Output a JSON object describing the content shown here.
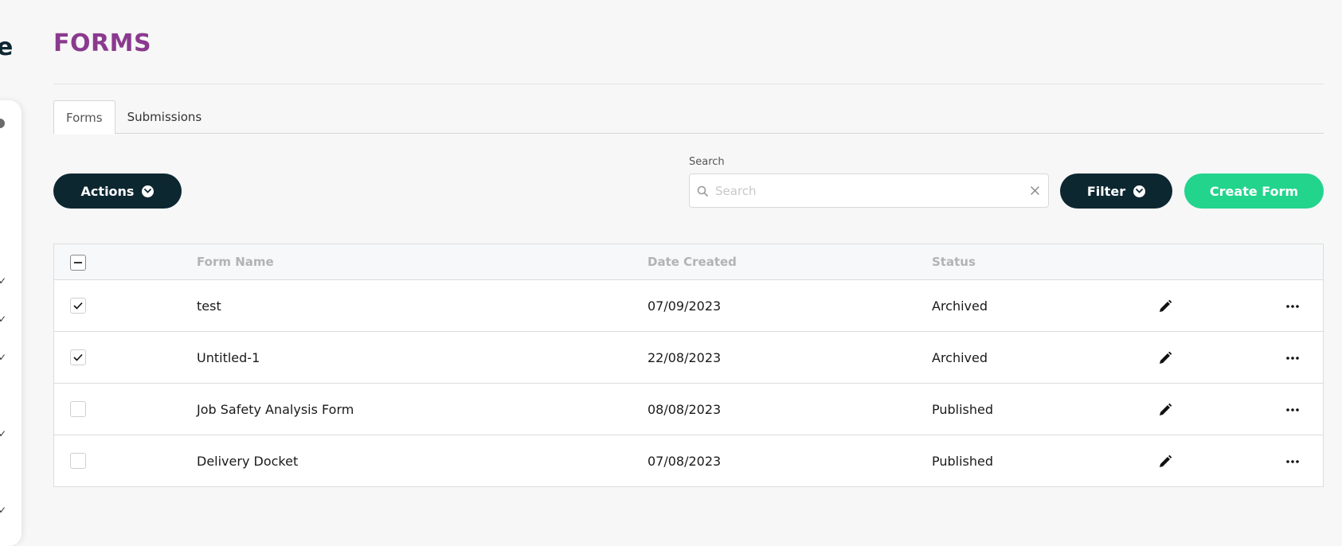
{
  "brand": {
    "fragment": "e"
  },
  "page": {
    "title": "FORMS"
  },
  "tabs": [
    {
      "label": "Forms",
      "active": true
    },
    {
      "label": "Submissions",
      "active": false
    }
  ],
  "toolbar": {
    "actions_label": "Actions",
    "search_label": "Search",
    "search_placeholder": "Search",
    "search_value": "",
    "filter_label": "Filter",
    "create_label": "Create Form"
  },
  "table": {
    "columns": [
      "Form Name",
      "Date Created",
      "Status"
    ],
    "rows": [
      {
        "name": "test",
        "date": "07/09/2023",
        "status": "Archived",
        "checked": true
      },
      {
        "name": "Untitled-1",
        "date": "22/08/2023",
        "status": "Archived",
        "checked": true
      },
      {
        "name": "Job Safety Analysis Form",
        "date": "08/08/2023",
        "status": "Published",
        "checked": false
      },
      {
        "name": "Delivery Docket",
        "date": "07/08/2023",
        "status": "Published",
        "checked": false
      }
    ]
  },
  "icons": {
    "select_all": "minus-icon",
    "row_check": "check-icon",
    "edit": "pencil-icon",
    "more": "ellipsis-icon",
    "search": "search-icon",
    "clear": "close-icon",
    "dropdown": "chevron-down-icon"
  },
  "colors": {
    "title": "#8a3a8e",
    "dark_button": "#0d2731",
    "accent_green": "#22d48c",
    "background": "#f7f7f7"
  }
}
